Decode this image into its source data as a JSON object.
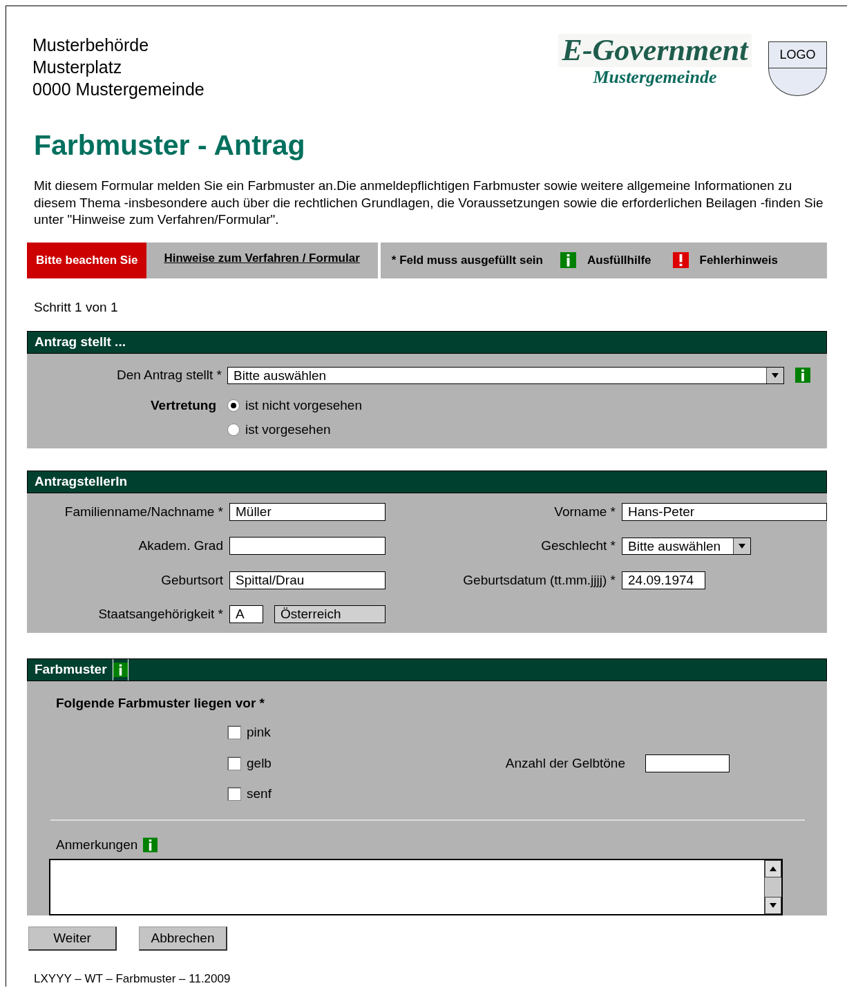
{
  "header": {
    "address_lines": [
      "Musterbehörde",
      "Musterplatz",
      "0000 Mustergemeinde"
    ],
    "brand_title": "E-Government",
    "brand_subtitle": "Mustergemeinde",
    "logo_label": "LOGO"
  },
  "title": "Farbmuster - Antrag",
  "intro": "Mit diesem Formular melden Sie ein Farbmuster an.Die anmeldepflichtigen Farbmuster sowie weitere allgemeine Informationen zu diesem Thema -insbesondere auch über die rechtlichen Grundlagen, die Voraussetzungen sowie die erforderlichen Beilagen -finden Sie unter \"Hinweise zum Verfahren/Formular\".",
  "notice_bar": {
    "notice": "Bitte beachten Sie",
    "link": "Hinweise zum Verfahren / Formular",
    "legend": [
      {
        "kind": "required",
        "label": "* Feld muss ausgefüllt sein"
      },
      {
        "kind": "info",
        "label": "Ausfüllhilfe"
      },
      {
        "kind": "error",
        "label": "Fehlerhinweis"
      }
    ]
  },
  "step": "Schritt 1 von 1",
  "section_applicant_type": {
    "title": "Antrag stellt ...",
    "field_label": "Den Antrag stellt *",
    "select_value": "Bitte auswählen",
    "radio_label": "Vertretung",
    "options": [
      {
        "label": "ist nicht vorgesehen",
        "selected": true
      },
      {
        "label": "ist vorgesehen",
        "selected": false
      }
    ]
  },
  "section_person": {
    "title": "AntragstellerIn",
    "fields": [
      {
        "kind": "text",
        "label": "Familienname/Nachname *",
        "value": "Müller"
      },
      {
        "kind": "text",
        "label": "Vorname *",
        "value": "Hans-Peter"
      },
      {
        "kind": "text",
        "label": "Akadem. Grad"
      },
      {
        "kind": "select",
        "label": "Geschlecht *",
        "value": "Bitte auswählen"
      },
      {
        "kind": "text",
        "label": "Geburtsort",
        "value": "Spittal/Drau"
      },
      {
        "kind": "date",
        "label": "Geburtsdatum (tt.mm.jjjj) *",
        "value": "24.09.1974"
      },
      {
        "kind": "country",
        "label": "Staatsangehörigkeit *",
        "code": "A",
        "value": "Österreich"
      }
    ]
  },
  "section_samples": {
    "title": "Farbmuster",
    "question": "Folgende Farbmuster liegen vor *",
    "options": [
      {
        "label": "pink",
        "checked": false
      },
      {
        "label": "gelb",
        "checked": false
      },
      {
        "label": "senf",
        "checked": false
      }
    ],
    "count_label": "Anzahl der Gelbtöne",
    "remarks_label": "Anmerkungen"
  },
  "buttons": [
    "Weiter",
    "Abbrechen"
  ],
  "footer": "LXYYY – WT – Farbmuster – 11.2009"
}
